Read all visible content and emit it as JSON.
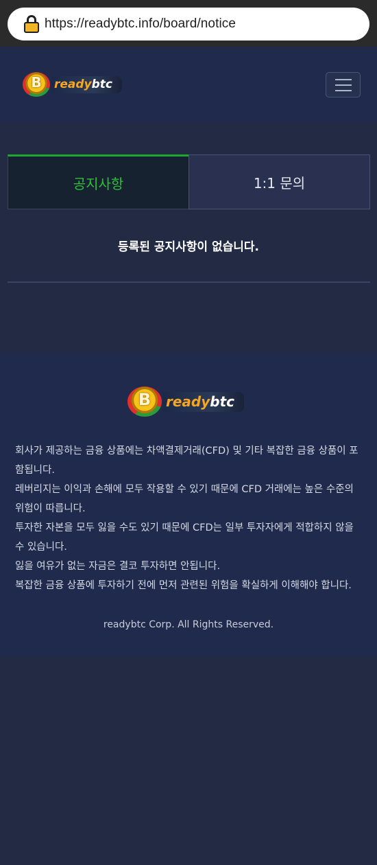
{
  "browser": {
    "url": "https://readybtc.info/board/notice"
  },
  "header": {
    "logo": {
      "brand_part1": "ready",
      "brand_part2": "btc",
      "coin_symbol": "B"
    },
    "menu_icon": "hamburger-icon"
  },
  "tabs": [
    {
      "label": "공지사항",
      "active": true
    },
    {
      "label": "1:1 문의",
      "active": false
    }
  ],
  "notice_list": {
    "empty_message": "등록된 공지사항이 없습니다."
  },
  "footer": {
    "logo": {
      "brand_part1": "ready",
      "brand_part2": "btc",
      "coin_symbol": "B"
    },
    "disclaimer": [
      "회사가 제공하는 금융 상품에는 차액결제거래(CFD) 및 기타 복잡한 금융 상품이 포함됩니다.",
      "레버리지는 이익과 손해에 모두 작용할 수 있기 때문에 CFD 거래에는 높은 수준의 위험이 따릅니다.",
      "투자한 자본을 모두 잃을 수도 있기 때문에 CFD는 일부 투자자에게 적합하지 않을 수 있습니다.",
      "잃을 여유가 없는 자금은 결코 투자하면 안됩니다.",
      "복잡한 금융 상품에 투자하기 전에 먼저 관련된 위험을 확실하게 이해해야 합니다."
    ],
    "copyright": "readybtc Corp. All Rights Reserved."
  },
  "colors": {
    "page_bg": "#232a44",
    "header_bg": "#1f2a4d",
    "tab_active_text": "#2fbf3a",
    "tab_active_border": "#1fa82b",
    "logo_orange": "#f5a623"
  }
}
